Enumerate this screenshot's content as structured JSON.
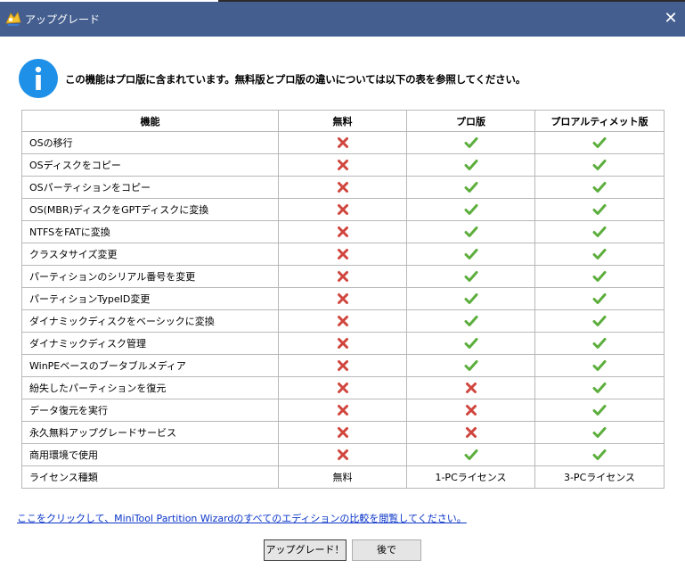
{
  "window": {
    "title": "アップグレード",
    "close_glyph": "✕"
  },
  "message": "この機能はプロ版に含まれています。無料版とプロ版の違いについては以下の表を参照してください。",
  "table": {
    "headers": [
      "機能",
      "無料",
      "プロ版",
      "プロアルティメット版"
    ],
    "rows": [
      {
        "feature": "OSの移行",
        "free": "no",
        "pro": "yes",
        "ultimate": "yes"
      },
      {
        "feature": "OSディスクをコピー",
        "free": "no",
        "pro": "yes",
        "ultimate": "yes"
      },
      {
        "feature": "OSパーティションをコピー",
        "free": "no",
        "pro": "yes",
        "ultimate": "yes"
      },
      {
        "feature": "OS(MBR)ディスクをGPTディスクに変換",
        "free": "no",
        "pro": "yes",
        "ultimate": "yes"
      },
      {
        "feature": "NTFSをFATに変換",
        "free": "no",
        "pro": "yes",
        "ultimate": "yes"
      },
      {
        "feature": "クラスタサイズ変更",
        "free": "no",
        "pro": "yes",
        "ultimate": "yes"
      },
      {
        "feature": "パーティションのシリアル番号を変更",
        "free": "no",
        "pro": "yes",
        "ultimate": "yes"
      },
      {
        "feature": "パーティションTypeID変更",
        "free": "no",
        "pro": "yes",
        "ultimate": "yes"
      },
      {
        "feature": "ダイナミックディスクをベーシックに変換",
        "free": "no",
        "pro": "yes",
        "ultimate": "yes"
      },
      {
        "feature": "ダイナミックディスク管理",
        "free": "no",
        "pro": "yes",
        "ultimate": "yes"
      },
      {
        "feature": "WinPEベースのブータブルメディア",
        "free": "no",
        "pro": "yes",
        "ultimate": "yes"
      },
      {
        "feature": "紛失したパーティションを復元",
        "free": "no",
        "pro": "no",
        "ultimate": "yes"
      },
      {
        "feature": "データ復元を実行",
        "free": "no",
        "pro": "no",
        "ultimate": "yes"
      },
      {
        "feature": "永久無料アップグレードサービス",
        "free": "no",
        "pro": "no",
        "ultimate": "yes"
      },
      {
        "feature": "商用環境で使用",
        "free": "no",
        "pro": "yes",
        "ultimate": "yes"
      }
    ],
    "license_row": {
      "feature": "ライセンス種類",
      "free": "無料",
      "pro": "1-PCライセンス",
      "ultimate": "3-PCライセンス"
    }
  },
  "compare_link": "ここをクリックして、MiniTool Partition Wizardのすべてのエディションの比較を閲覧してください。",
  "buttons": {
    "upgrade": "アップグレード！",
    "later": "後で"
  },
  "colors": {
    "titlebar": "#435e8f",
    "info_icon": "#1e90e8",
    "check": "#5cae3c",
    "cross": "#d0453d",
    "link": "#0a35c8"
  }
}
